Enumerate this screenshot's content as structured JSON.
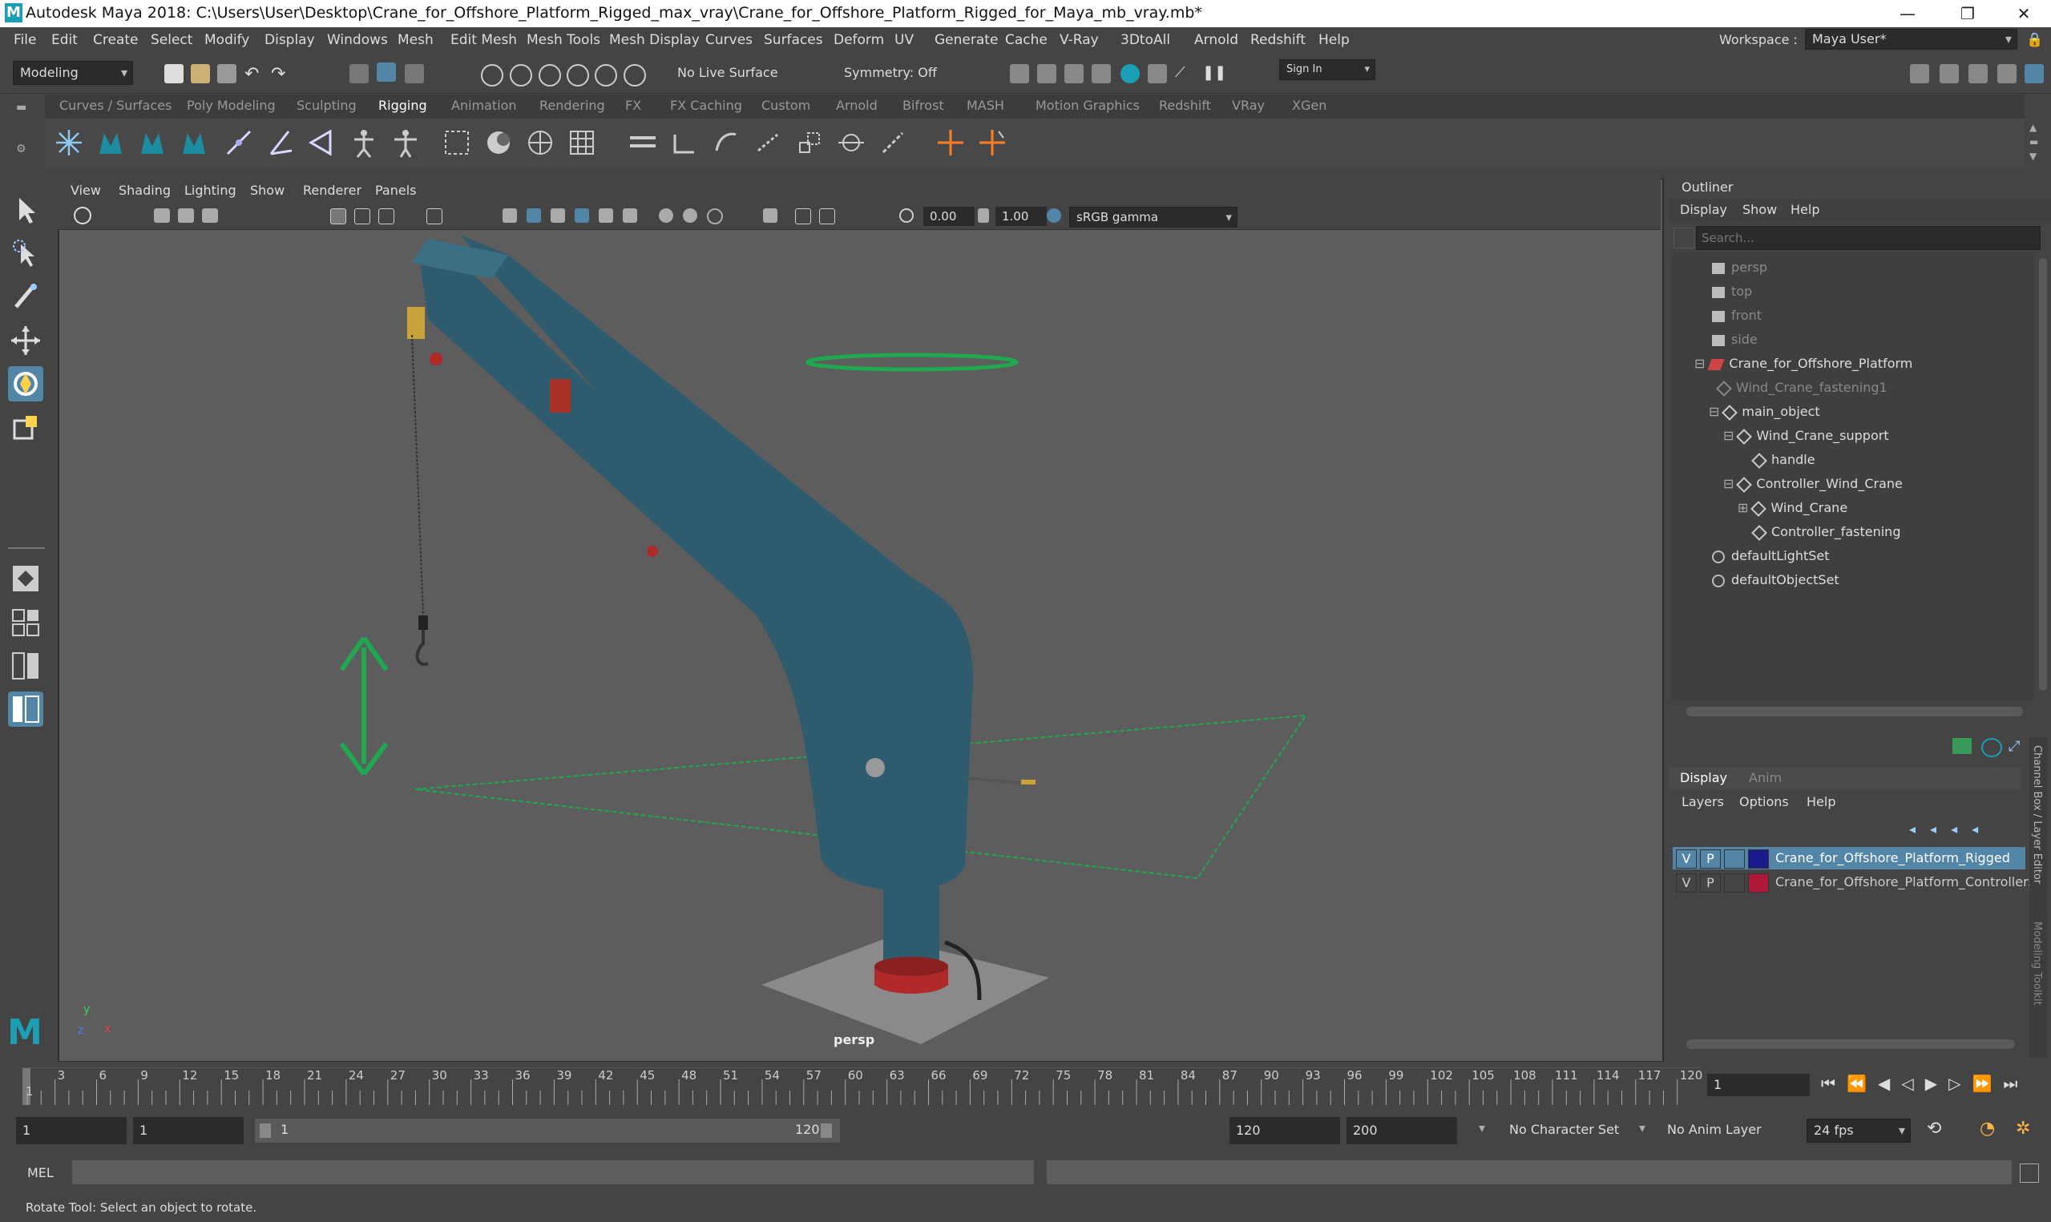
{
  "titlebar": {
    "title": "Autodesk Maya 2018: C:\\Users\\User\\Desktop\\Crane_for_Offshore_Platform_Rigged_max_vray\\Crane_for_Offshore_Platform_Rigged_for_Maya_mb_vray.mb*",
    "logo": "M",
    "minimize": "—",
    "maximize": "❐",
    "close": "✕"
  },
  "menubar": {
    "items": [
      "File",
      "Edit",
      "Create",
      "Select",
      "Modify",
      "Display",
      "Windows",
      "Mesh",
      "Edit Mesh",
      "Mesh Tools",
      "Mesh Display",
      "Curves",
      "Surfaces",
      "Deform",
      "UV",
      "Generate",
      "Cache",
      "V-Ray",
      "3DtoAll",
      "Arnold",
      "Redshift",
      "Help"
    ],
    "workspace_label": "Workspace :",
    "workspace_value": "Maya User*"
  },
  "statusline": {
    "mode": "Modeling",
    "live_surface": "No Live Surface",
    "symmetry": "Symmetry: Off",
    "sign_in": "Sign In"
  },
  "shelf": {
    "tabs": [
      "Curves / Surfaces",
      "Poly Modeling",
      "Sculpting",
      "Rigging",
      "Animation",
      "Rendering",
      "FX",
      "FX Caching",
      "Custom",
      "Arnold",
      "Bifrost",
      "MASH",
      "Motion Graphics",
      "Redshift",
      "VRay",
      "XGen"
    ],
    "active_tab": "Rigging"
  },
  "viewport": {
    "menus": [
      "View",
      "Shading",
      "Lighting",
      "Show",
      "Renderer",
      "Panels"
    ],
    "exposure": "0.00",
    "gamma": "1.00",
    "color_space": "sRGB gamma",
    "camera_label": "persp",
    "axis_y": "y",
    "axis_x": "x",
    "axis_z": "z"
  },
  "outliner": {
    "title": "Outliner",
    "menus": [
      "Display",
      "Show",
      "Help"
    ],
    "search_placeholder": "Search...",
    "items": [
      {
        "label": "persp",
        "type": "camera",
        "dim": true
      },
      {
        "label": "top",
        "type": "camera",
        "dim": true
      },
      {
        "label": "front",
        "type": "camera",
        "dim": true
      },
      {
        "label": "side",
        "type": "camera",
        "dim": true
      },
      {
        "label": "Crane_for_Offshore_Platform",
        "type": "group",
        "dim": false
      },
      {
        "label": "Wind_Crane_fastening1",
        "type": "node",
        "dim": true
      },
      {
        "label": "main_object",
        "type": "node",
        "dim": false
      },
      {
        "label": "Wind_Crane_support",
        "type": "node",
        "dim": false
      },
      {
        "label": "handle",
        "type": "node",
        "dim": false
      },
      {
        "label": "Controller_Wind_Crane",
        "type": "node",
        "dim": false
      },
      {
        "label": "Wind_Crane",
        "type": "node",
        "dim": false
      },
      {
        "label": "Controller_fastening",
        "type": "node",
        "dim": false
      },
      {
        "label": "defaultLightSet",
        "type": "set",
        "dim": false
      },
      {
        "label": "defaultObjectSet",
        "type": "set",
        "dim": false
      }
    ]
  },
  "layers": {
    "tabs": [
      "Display",
      "Anim"
    ],
    "menus": [
      "Layers",
      "Options",
      "Help"
    ],
    "rows": [
      {
        "v": "V",
        "p": "P",
        "color": "#1a1a8c",
        "name": "Crane_for_Offshore_Platform_Rigged",
        "selected": true
      },
      {
        "v": "V",
        "p": "P",
        "color": "#b0183a",
        "name": "Crane_for_Offshore_Platform_Controllers",
        "selected": false
      }
    ],
    "side_tab_1": "Channel Box / Layer Editor",
    "side_tab_2": "Modeling Toolkit"
  },
  "timeline": {
    "ticks": [
      "3",
      "6",
      "9",
      "12",
      "15",
      "18",
      "21",
      "24",
      "27",
      "30",
      "33",
      "36",
      "39",
      "42",
      "45",
      "48",
      "51",
      "54",
      "57",
      "60",
      "63",
      "66",
      "69",
      "72",
      "75",
      "78",
      "81",
      "84",
      "87",
      "90",
      "93",
      "96",
      "99",
      "102",
      "105",
      "108",
      "111",
      "114",
      "117",
      "120"
    ],
    "current_marker": "1",
    "current_frame": "1"
  },
  "range": {
    "start": "1",
    "playback_start": "1",
    "slider_start": "1",
    "slider_end": "120",
    "playback_end": "120",
    "end": "200",
    "character_set": "No Character Set",
    "anim_layer": "No Anim Layer",
    "fps": "24 fps"
  },
  "cmdline": {
    "label": "MEL"
  },
  "helpline": {
    "text": "Rotate Tool: Select an object to rotate."
  },
  "colors": {
    "accent": "#5285a6",
    "crane_body": "#2e5b6e",
    "controller_green": "#1fa84f"
  }
}
